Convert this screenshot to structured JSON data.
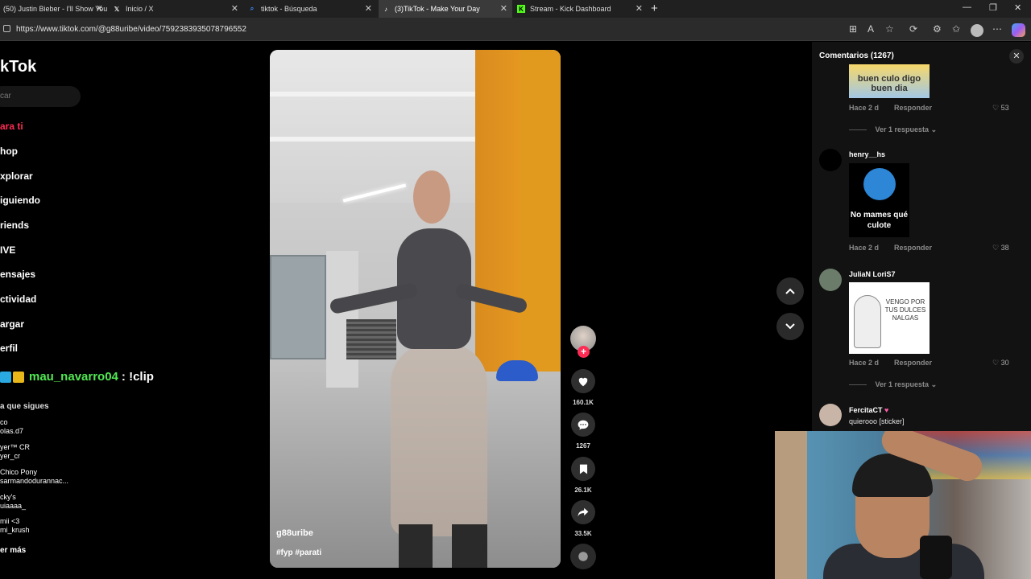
{
  "browser": {
    "tabs": [
      {
        "label": "(50) Justin Bieber - I'll Show You",
        "icon": "youtube-icon",
        "color": "#ff0000"
      },
      {
        "label": "Inicio / X",
        "icon": "x-icon",
        "color": "#ffffff"
      },
      {
        "label": "tiktok - Búsqueda",
        "icon": "search-icon",
        "color": "#3d8bff"
      },
      {
        "label": "(3)TikTok - Make Your Day",
        "icon": "tiktok-icon",
        "color": "#ffffff"
      },
      {
        "label": "Stream - Kick Dashboard",
        "icon": "kick-icon",
        "color": "#53fc18"
      }
    ],
    "new_tab": "+",
    "url": "https://www.tiktok.com/@g88uribe/video/7592383935078796552"
  },
  "sidebar": {
    "logo": "kTok",
    "search_placeholder": "car",
    "items": [
      {
        "label": "ara ti"
      },
      {
        "label": "hop"
      },
      {
        "label": "xplorar"
      },
      {
        "label": "iguiendo"
      },
      {
        "label": "riends"
      },
      {
        "label": "IVE"
      },
      {
        "label": "ensajes"
      },
      {
        "label": "ctividad"
      },
      {
        "label": "argar"
      },
      {
        "label": "erfil"
      }
    ],
    "following_heading": "a que sigues",
    "following": [
      {
        "name": "co",
        "handle": "olas.d7"
      },
      {
        "name": "yer™ CR",
        "handle": "yer_cr"
      },
      {
        "name": "Chico Pony",
        "handle": "sarmandodurannac..."
      },
      {
        "name": "cky's",
        "handle": "uiaaaa_"
      },
      {
        "name": "mii <3",
        "handle": "mi_krush"
      }
    ],
    "see_more": "er más"
  },
  "stream_chat": {
    "user": "mau_navarro04",
    "message": ": !clip"
  },
  "video": {
    "author": "g88uribe",
    "hashtags": "#fyp #parati",
    "likes": "160.1K",
    "comments": "1267",
    "saves": "26.1K",
    "shares": "33.5K",
    "follow_plus": "+"
  },
  "comments_panel": {
    "title": "Comentarios (1267)",
    "close": "✕",
    "items": [
      {
        "user": "",
        "sticker_text": "buen culo digo buen dia",
        "time": "Hace 2 d",
        "reply": "Responder",
        "likes": "53",
        "more": "Ver 1 respuesta"
      },
      {
        "user": "henry__hs",
        "sticker_text": "No mames qué culote",
        "time": "Hace 2 d",
        "reply": "Responder",
        "likes": "38"
      },
      {
        "user": "JuliaN LoriS7",
        "sticker_text": "VENGO POR TUS DULCES NALGAS",
        "time": "Hace 2 d",
        "reply": "Responder",
        "likes": "30",
        "more": "Ver 1 respuesta"
      },
      {
        "user": "FercitaCT",
        "text": "quierooo [sticker]"
      }
    ]
  },
  "colors": {
    "accent": "#fe2c55",
    "chat_user": "#52e852"
  }
}
